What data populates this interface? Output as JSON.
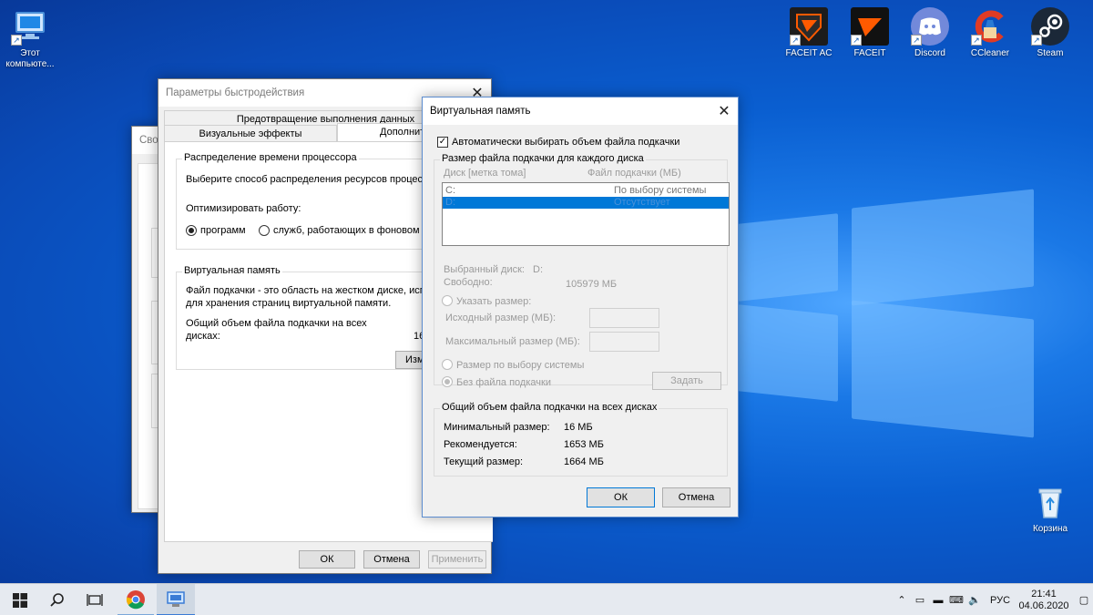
{
  "desktop": {
    "icons": [
      {
        "label": "Этот компьюте...",
        "icon": "this-pc-icon"
      },
      {
        "label": "FACEIT AC",
        "icon": "faceit-ac-icon"
      },
      {
        "label": "FACEIT",
        "icon": "faceit-icon"
      },
      {
        "label": "Discord",
        "icon": "discord-icon"
      },
      {
        "label": "CCleaner",
        "icon": "ccleaner-icon"
      },
      {
        "label": "Steam",
        "icon": "steam-icon"
      },
      {
        "label": "Корзина",
        "icon": "recycle-bin-icon"
      }
    ]
  },
  "bg_window": {
    "title": "Свой"
  },
  "perf_window": {
    "title": "Параметры быстродействия",
    "tabs": [
      "Предотвращение выполнения данных",
      "Визуальные эффекты",
      "Дополните"
    ],
    "cpu_group": {
      "caption": "Распределение времени процессора",
      "desc": "Выберите способ распределения ресурсов процессо",
      "optimize_label": "Оптимизировать работу:",
      "opt_programs": "программ",
      "opt_services": "служб, работающих в фоновом р"
    },
    "vm_group": {
      "caption": "Виртуальная память",
      "desc1": "Файл подкачки - это область на жестком диске, испо",
      "desc2": "для хранения страниц виртуальной памяти.",
      "total1": "Общий объем файла подкачки на всех",
      "total2": "дисках:",
      "total_value": "16",
      "change_button": "Изм"
    },
    "buttons": {
      "ok": "ОК",
      "cancel": "Отмена",
      "apply": "Применить"
    }
  },
  "vm_dialog": {
    "title": "Виртуальная память",
    "auto_checkbox": "Автоматически выбирать объем файла подкачки",
    "per_disk_group": {
      "caption": "Размер файла подкачки для каждого диска",
      "col_disk": "Диск [метка тома]",
      "col_size": "Файл подкачки (МБ)",
      "rows": [
        {
          "disk": "C:",
          "size": "По выбору системы"
        },
        {
          "disk": "D:",
          "size": "Отсутствует"
        }
      ],
      "selected_disk_label": "Выбранный диск:",
      "selected_disk_value": "D:",
      "free_label": "Свободно:",
      "free_value": "105979 МБ",
      "custom_size": "Указать размер:",
      "initial_size": "Исходный размер (МБ):",
      "max_size": "Максимальный размер (МБ):",
      "system_size": "Размер по выбору системы",
      "no_paging": "Без файла подкачки",
      "set_button": "Задать"
    },
    "total_group": {
      "caption": "Общий объем файла подкачки на всех дисках",
      "min_label": "Минимальный размер:",
      "min_value": "16 МБ",
      "rec_label": "Рекомендуется:",
      "rec_value": "1653 МБ",
      "cur_label": "Текущий размер:",
      "cur_value": "1664 МБ"
    },
    "buttons": {
      "ok": "ОК",
      "cancel": "Отмена"
    }
  },
  "taskbar": {
    "language": "РУС",
    "time": "21:41",
    "date": "04.06.2020"
  }
}
